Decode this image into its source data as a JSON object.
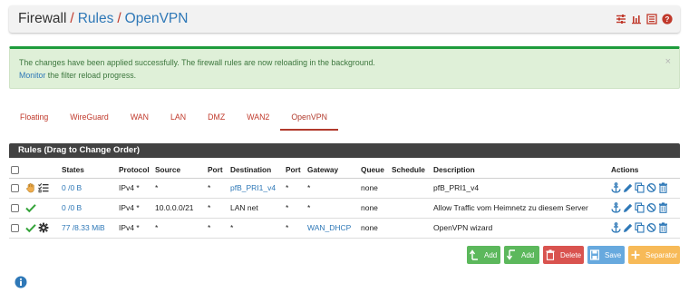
{
  "breadcrumb": {
    "root": "Firewall",
    "rules": "Rules",
    "current": "OpenVPN",
    "sep1": "/",
    "sep2": "/"
  },
  "header_icons": [
    "sliders-icon",
    "chart-icon",
    "list-icon",
    "help-icon"
  ],
  "alert": {
    "message": "The changes have been applied successfully. The firewall rules are now reloading in the background.",
    "link": "Monitor",
    "suffix": " the filter reload progress.",
    "close": "×"
  },
  "tabs": [
    {
      "label": "Floating"
    },
    {
      "label": "WireGuard"
    },
    {
      "label": "WAN"
    },
    {
      "label": "LAN"
    },
    {
      "label": "DMZ"
    },
    {
      "label": "WAN2"
    },
    {
      "label": "OpenVPN"
    }
  ],
  "active_tab": "OpenVPN",
  "panel_title": "Rules (Drag to Change Order)",
  "table": {
    "headers": {
      "states": "States",
      "protocol": "Protocol",
      "source": "Source",
      "sport": "Port",
      "destination": "Destination",
      "dport": "Port",
      "gateway": "Gateway",
      "queue": "Queue",
      "schedule": "Schedule",
      "description": "Description",
      "actions": "Actions"
    },
    "rows": [
      {
        "status_icons": [
          "hand-icon",
          "list-check-icon"
        ],
        "states": "0 /0 B",
        "protocol": "IPv4 *",
        "source": "*",
        "sport": "*",
        "destination": "pfB_PRI1_v4",
        "dport": "*",
        "gateway": "*",
        "queue": "none",
        "schedule": "",
        "description": "pfB_PRI1_v4"
      },
      {
        "status_icons": [
          "check-icon"
        ],
        "states": "0 /0 B",
        "protocol": "IPv4 *",
        "source": "10.0.0.0/21",
        "sport": "*",
        "destination": "LAN net",
        "dport": "*",
        "gateway": "*",
        "queue": "none",
        "schedule": "",
        "description": "Allow Traffic vom Heimnetz zu diesem Server"
      },
      {
        "status_icons": [
          "check-icon",
          "gear-icon"
        ],
        "states": "77 /8.33 MiB",
        "protocol": "IPv4 *",
        "source": "*",
        "sport": "*",
        "destination": "*",
        "dport": "*",
        "gateway": "WAN_DHCP",
        "queue": "none",
        "schedule": "",
        "description": "OpenVPN wizard"
      }
    ]
  },
  "buttons": {
    "add_top": "Add",
    "add_bottom": "Add",
    "delete": "Delete",
    "save": "Save",
    "separator": "Separator"
  },
  "colors": {
    "success": "#5cb85c",
    "danger": "#d9534f",
    "info": "#67a9de",
    "warning": "#f7ba58",
    "link": "#2e78b7",
    "accent_red": "#c0392b"
  }
}
